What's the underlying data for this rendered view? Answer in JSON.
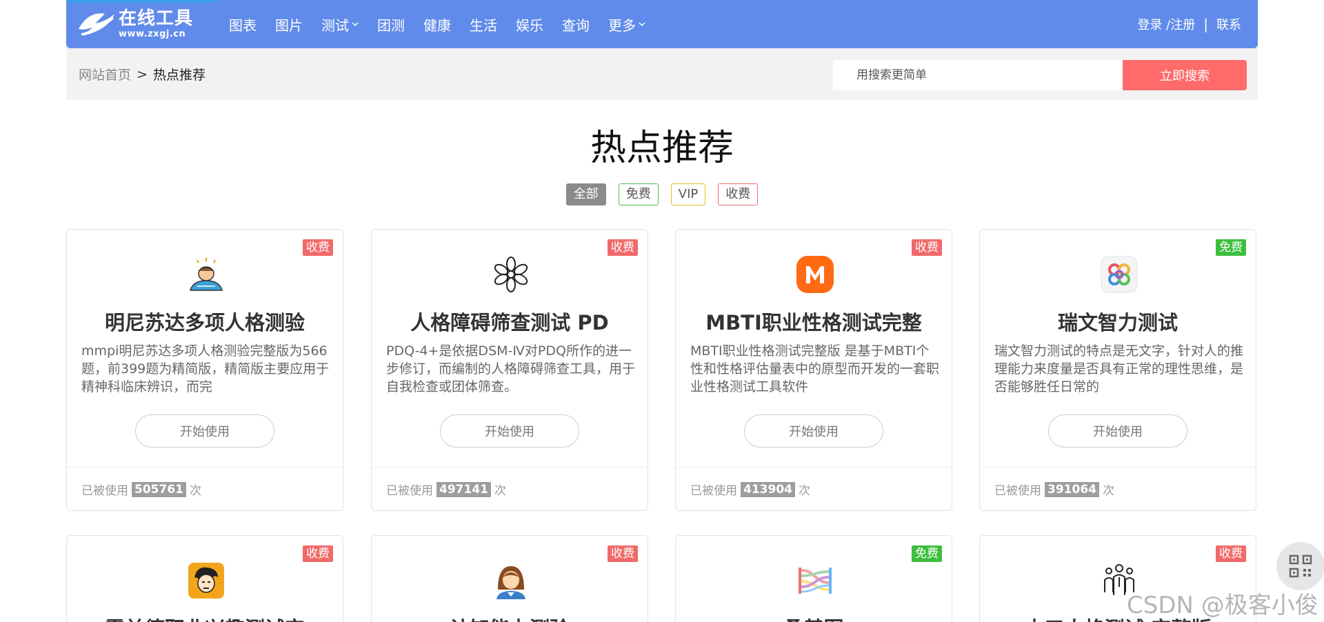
{
  "logo": {
    "title": "在线工具",
    "url": "www.zxgj.cn"
  },
  "nav": {
    "items": [
      {
        "label": "图表",
        "dropdown": false
      },
      {
        "label": "图片",
        "dropdown": false
      },
      {
        "label": "测试",
        "dropdown": true
      },
      {
        "label": "团测",
        "dropdown": false
      },
      {
        "label": "健康",
        "dropdown": false
      },
      {
        "label": "生活",
        "dropdown": false
      },
      {
        "label": "娱乐",
        "dropdown": false
      },
      {
        "label": "查询",
        "dropdown": false
      },
      {
        "label": "更多",
        "dropdown": true
      }
    ],
    "login": "登录 /注册",
    "separator": "|",
    "contact": "联系"
  },
  "breadcrumb": {
    "home": "网站首页",
    "separator": ">",
    "current": "热点推荐"
  },
  "search": {
    "placeholder": "用搜索更简单",
    "button": "立即搜索"
  },
  "page_title": "热点推荐",
  "filters": [
    "全部",
    "免费",
    "VIP",
    "收费"
  ],
  "usage": {
    "prefix": "已被使用",
    "suffix": "次"
  },
  "start_label": "开始使用",
  "colors": {
    "nav_bg": "#608bea",
    "search_button": "#ff6b6b",
    "paid_badge": "#f06a6a",
    "free_badge": "#3dbf3d"
  },
  "cards": [
    {
      "badge": "收费",
      "badge_type": "paid",
      "icon": "person-bowing-icon",
      "title": "明尼苏达多项人格测验",
      "desc": "mmpi明尼苏达多项人格测验完整版为566题，前399题为精简版，精简版主要应用于精神科临床辨识，而完",
      "count": "505761"
    },
    {
      "badge": "收费",
      "badge_type": "paid",
      "icon": "flower-icon",
      "title": "人格障碍筛查测试 PD",
      "desc": "PDQ-4+是依据DSM-Ⅳ对PDQ所作的进一步修订，而编制的人格障碍筛查工具，用于自我检查或团体筛查。",
      "count": "497141"
    },
    {
      "badge": "收费",
      "badge_type": "paid",
      "icon": "m-logo-icon",
      "title": "MBTI职业性格测试完整",
      "desc": "MBTI职业性格测试完整版 是基于MBTI个性和性格评估量表中的原型而开发的一套职业性格测试工具软件",
      "count": "413904"
    },
    {
      "badge": "免费",
      "badge_type": "free",
      "icon": "knot-logo-icon",
      "title": "瑞文智力测试",
      "desc": "瑞文智力测试的特点是无文字，针对人的推理能力来度量是否具有正常的理性思维，是否能够胜任日常的",
      "count": "391064"
    },
    {
      "badge": "收费",
      "badge_type": "paid",
      "icon": "man-face-icon",
      "title": "霍兰德职业兴趣测试完",
      "desc": "",
      "count": ""
    },
    {
      "badge": "收费",
      "badge_type": "paid",
      "icon": "woman-avatar-icon",
      "title": "认知能力测验",
      "desc": "",
      "count": ""
    },
    {
      "badge": "免费",
      "badge_type": "free",
      "icon": "sankey-chart-icon",
      "title": "桑基图",
      "desc": "",
      "count": ""
    },
    {
      "badge": "收费",
      "badge_type": "paid",
      "icon": "people-group-icon",
      "title": "大五人格测试 完整版",
      "desc": "",
      "count": ""
    }
  ],
  "watermark": "CSDN @极客小俊"
}
